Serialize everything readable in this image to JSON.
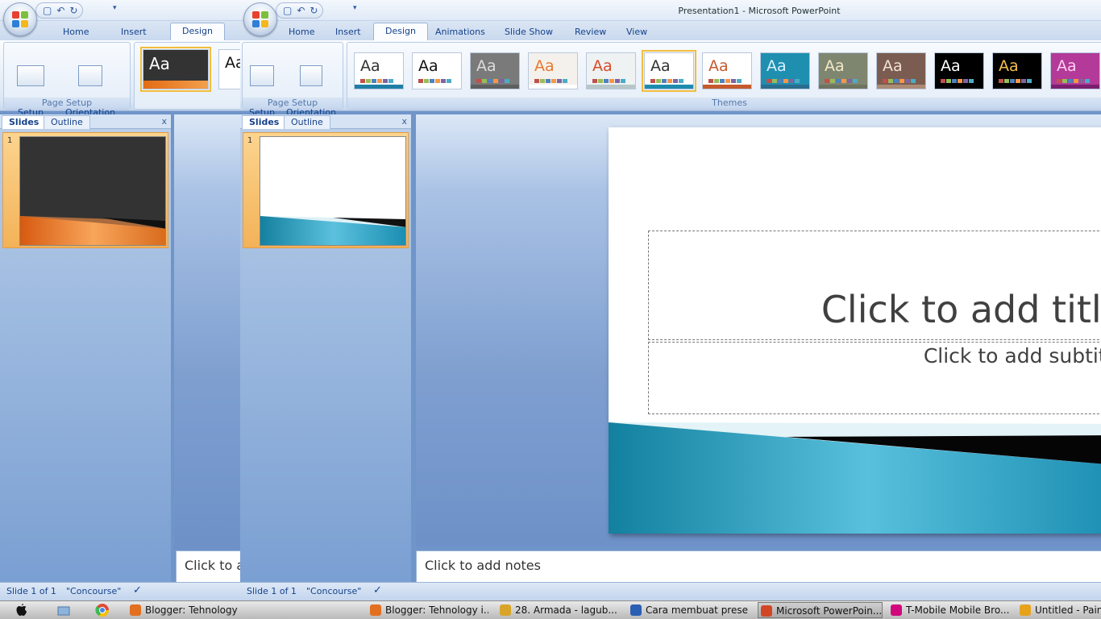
{
  "window_title": "Presentation1 - Microsoft PowerPoint",
  "qat": {
    "save": "⬜",
    "undo": "↶",
    "redo": "↻",
    "more": "▾"
  },
  "tabs_back": {
    "home": "Home",
    "insert": "Insert",
    "design": "Design"
  },
  "tabs": [
    {
      "label": "Home"
    },
    {
      "label": "Insert"
    },
    {
      "label": "Design"
    },
    {
      "label": "Animations"
    },
    {
      "label": "Slide Show"
    },
    {
      "label": "Review"
    },
    {
      "label": "View"
    }
  ],
  "page_setup": {
    "page_setup_label": "Page\nSetup",
    "orientation_label": "Slide\nOrientation",
    "group_label": "Page Setup"
  },
  "themes": {
    "group_label": "Themes",
    "sample_text": "Aa",
    "items": [
      {
        "bg": "#ffffff",
        "fg": "#333333",
        "bar": "#1f7ea6"
      },
      {
        "bg": "#ffffff",
        "fg": "#111111",
        "bar": "#ffffff"
      },
      {
        "bg": "#7a7a7a",
        "fg": "#dddddd",
        "bar": "#5f5f5f"
      },
      {
        "bg": "#f4f1ec",
        "fg": "#e57a30",
        "bar": "#ffffff"
      },
      {
        "bg": "#eef2f2",
        "fg": "#d94a2a",
        "bar": "#b7c7c9"
      },
      {
        "bg": "#ffffff",
        "fg": "#333333",
        "bar": "#1c8cae"
      },
      {
        "bg": "#ffffff",
        "fg": "#c55a2d",
        "bar": "#c55a2d"
      },
      {
        "bg": "#1f8fb0",
        "fg": "#d9f2ff",
        "bar": "#2a6d8f"
      },
      {
        "bg": "#7f8670",
        "fg": "#f1e9c8",
        "bar": "#6d7460"
      },
      {
        "bg": "#7a5d50",
        "fg": "#f1e3d6",
        "bar": "#ab8b75"
      },
      {
        "bg": "#000000",
        "fg": "#ffffff",
        "bar": "#000000"
      },
      {
        "bg": "#000000",
        "fg": "#f5c04a",
        "bar": "#000000"
      },
      {
        "bg": "#b33a98",
        "fg": "#ffd0f2",
        "bar": "#7b1f6f"
      }
    ]
  },
  "slides_panel": {
    "slides_tab": "Slides",
    "outline_tab": "Outline",
    "close": "x",
    "slide_number": "1"
  },
  "slide": {
    "title_placeholder": "Click to add title",
    "subtitle_placeholder": "Click to add subtitle"
  },
  "notes": {
    "placeholder": "Click to add notes",
    "placeholder_back": "Click to ac"
  },
  "status": {
    "slide_info": "Slide 1 of 1",
    "theme_name": "\"Concourse\"",
    "check": "✓"
  },
  "taskbar": {
    "items": [
      {
        "label": "Blogger: Tehnology i...",
        "color": "#e3701f"
      },
      {
        "label": "Blogger: Tehnology i...",
        "color": "#e3701f"
      },
      {
        "label": "28. Armada  - lagub...",
        "color": "#d8a52a"
      },
      {
        "label": "Cara membuat prese...",
        "color": "#2a5fb3"
      },
      {
        "label": "Microsoft PowerPoin...",
        "color": "#d24625"
      },
      {
        "label": "T-Mobile Mobile Bro...",
        "color": "#d0087c"
      },
      {
        "label": "Untitled - Paint",
        "color": "#e7a21c"
      }
    ]
  },
  "colors": {
    "accent": "#15428b",
    "selection": "#f2bd3d",
    "concourse_teal": "#1b8db0"
  }
}
